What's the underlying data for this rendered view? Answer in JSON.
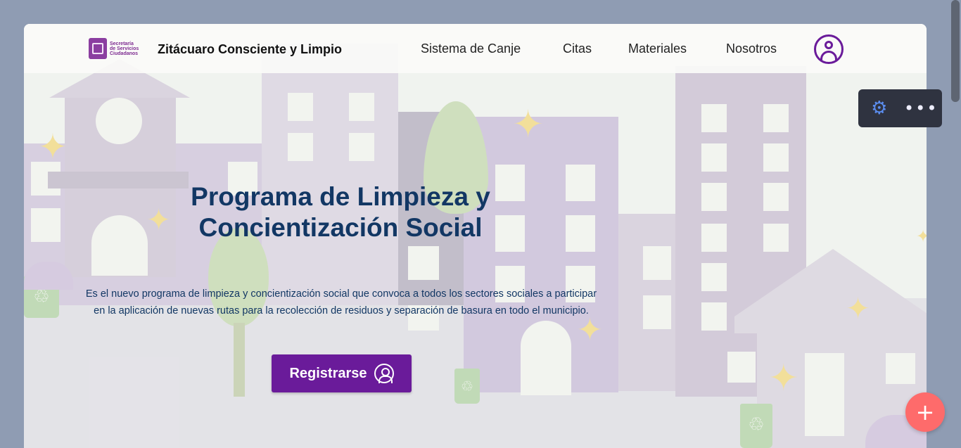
{
  "navbar": {
    "logo_text": "Secretaría\nde Servicios\nCiudadanos",
    "brand": "Zitácuaro Consciente y Limpio",
    "items": [
      {
        "label": "Sistema de Canje"
      },
      {
        "label": "Citas"
      },
      {
        "label": "Materiales"
      },
      {
        "label": "Nosotros"
      }
    ],
    "user_icon": "user-circle-icon"
  },
  "hero": {
    "title": "Programa de Limpieza y Concientización Social",
    "description": "Es el nuevo programa de limpieza y concientización social que convoca a todos los sectores sociales a participar en la aplicación de nuevas rutas para la recolección de residuos y separación de basura en todo el municipio.",
    "register_label": "Registrarse",
    "register_icon": "user-circle-icon"
  },
  "toolbar": {
    "settings_icon": "gear-icon",
    "more_icon": "more-dots-icon",
    "settings_glyph": "⚙",
    "more_glyph": "•••"
  },
  "fab": {
    "icon": "plus-icon",
    "glyph": "+"
  },
  "colors": {
    "primary": "#6a1b9a",
    "title": "#123764",
    "fab": "#fe6b6b",
    "toolbar": "#2f3340"
  }
}
